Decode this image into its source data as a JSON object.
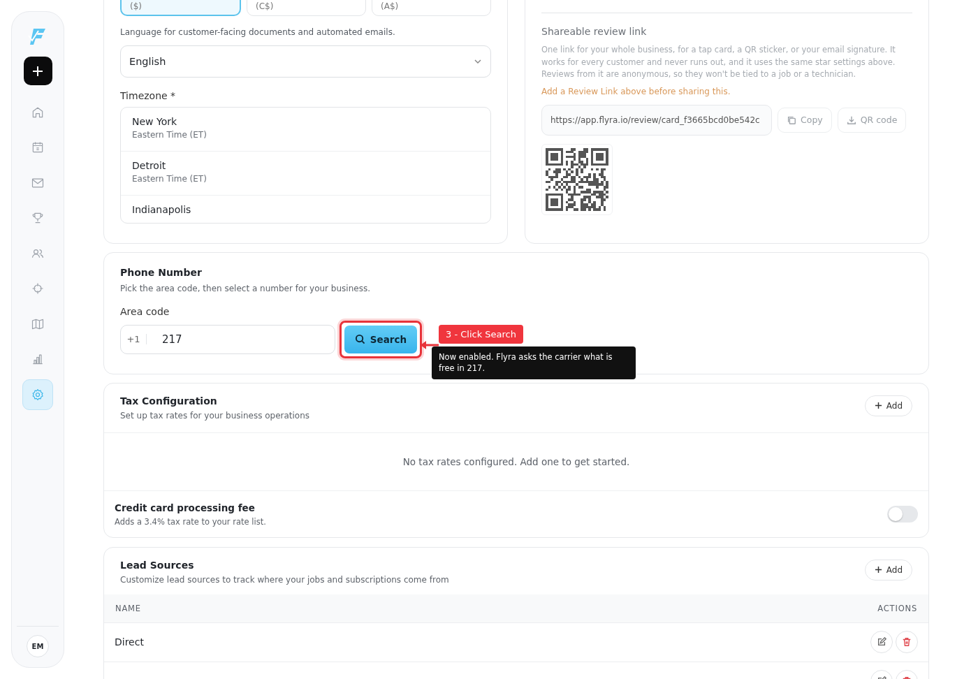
{
  "sidebar": {
    "avatar": "EM",
    "nav_items": [
      {
        "kind": "home",
        "selected": false
      },
      {
        "kind": "calendar",
        "selected": false
      },
      {
        "kind": "mail",
        "selected": false
      },
      {
        "kind": "trophy",
        "selected": false
      },
      {
        "kind": "users",
        "selected": false
      },
      {
        "kind": "target",
        "selected": false
      },
      {
        "kind": "map",
        "selected": false
      },
      {
        "kind": "chart",
        "selected": false
      },
      {
        "kind": "settings",
        "selected": true
      }
    ]
  },
  "currency_options": [
    {
      "label": "($)",
      "selected": true
    },
    {
      "label": "(C$)",
      "selected": false
    },
    {
      "label": "(A$)",
      "selected": false
    }
  ],
  "language": {
    "hint": "Language for customer-facing documents and automated emails.",
    "value": "English"
  },
  "timezone": {
    "label": "Timezone *",
    "options": [
      {
        "city": "New York",
        "zone": "Eastern Time (ET)"
      },
      {
        "city": "Detroit",
        "zone": "Eastern Time (ET)"
      },
      {
        "city": "Indianapolis"
      }
    ]
  },
  "review_link": {
    "title": "Shareable review link",
    "description": "One link for your whole business, for a tap card, a QR sticker, or your email signature. It works for every customer and never runs out, and it uses the same star settings above. Reviews from it are anonymous, so they won't be tied to a job or a technician.",
    "warning": "Add a Review Link above before sharing this.",
    "url": "https://app.flyra.io/review/card_f3665bcd0be542c",
    "copy": "Copy",
    "qr": "QR code"
  },
  "phone_number": {
    "title": "Phone Number",
    "description": "Pick the area code, then select a number for your business.",
    "area_code_label": "Area code",
    "prefix": "+1",
    "area_code": "217",
    "search": "Search",
    "callout": {
      "step": "3 - Click Search",
      "note": "Now enabled. Flyra asks the carrier what is free in 217."
    }
  },
  "tax_configuration": {
    "title": "Tax Configuration",
    "subtitle": "Set up tax rates for your business operations",
    "add": "Add",
    "empty": "No tax rates configured. Add one to get started.",
    "fee": {
      "title": "Credit card processing fee",
      "subtitle": "Adds a 3.4% tax rate to your rate list.",
      "on": false
    }
  },
  "lead_sources": {
    "title": "Lead Sources",
    "subtitle": "Customize lead sources to track where your jobs and subscriptions come from",
    "add": "Add",
    "columns": [
      "NAME",
      "ACTIONS"
    ],
    "rows": [
      {
        "name": "Direct"
      },
      {}
    ]
  }
}
